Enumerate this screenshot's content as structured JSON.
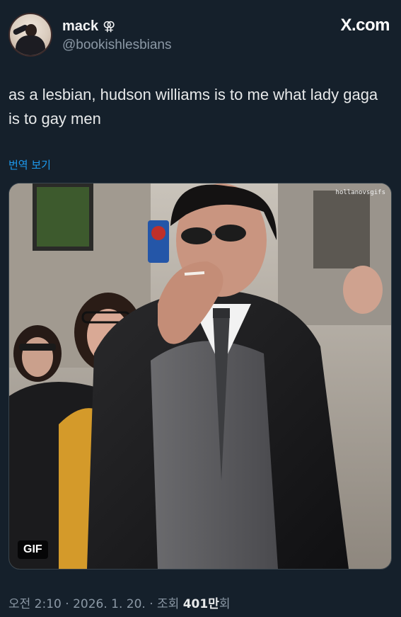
{
  "user": {
    "display_name": "mack",
    "symbol": "⚢",
    "handle": "@bookishlesbians"
  },
  "brand": {
    "label": "X.com"
  },
  "tweet": {
    "text": "as a lesbian, hudson williams is to me what lady gaga is to gay men",
    "translate_label": "번역 보기"
  },
  "media": {
    "watermark": "hollanovsgifs",
    "badge": "GIF"
  },
  "meta": {
    "time": "오전 2:10 · 2026. 1. 20. · 조회",
    "views_count": "401만",
    "views_suffix": "회"
  },
  "colors": {
    "background": "#15202b",
    "text": "#e7e9ea",
    "secondary": "#8b98a5",
    "link": "#1d9bf0"
  }
}
